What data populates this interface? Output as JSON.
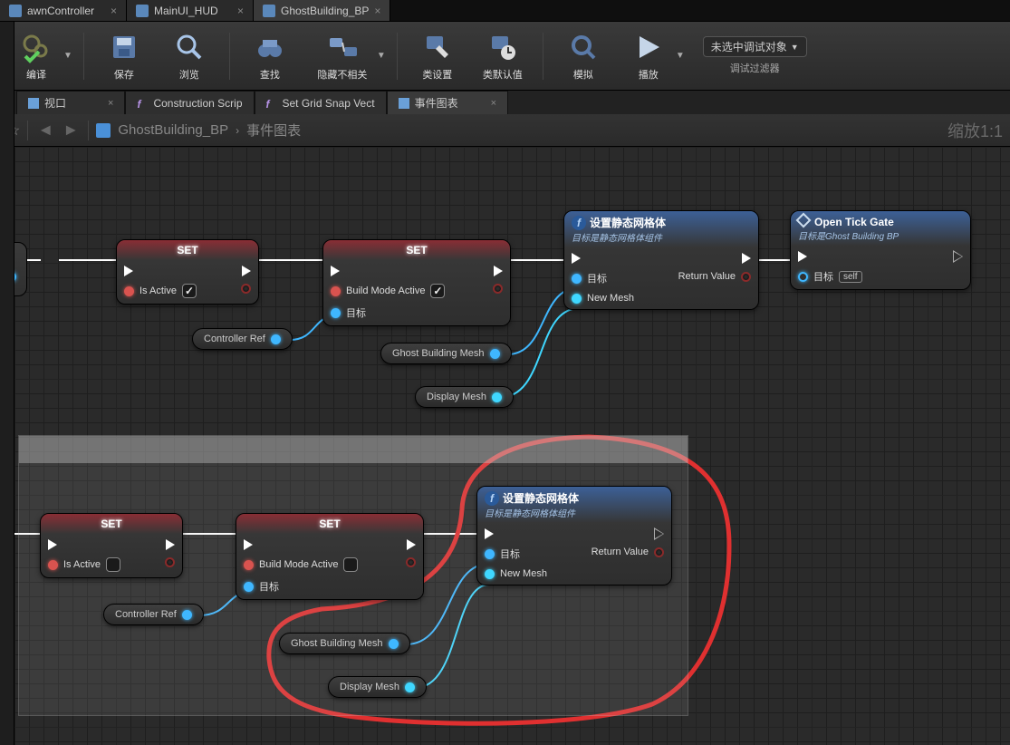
{
  "fileTabs": [
    {
      "label": "awnController"
    },
    {
      "label": "MainUI_HUD"
    },
    {
      "label": "GhostBuilding_BP",
      "active": true
    }
  ],
  "toolbar": {
    "compile": "编译",
    "save": "保存",
    "browse": "浏览",
    "find": "查找",
    "hideUnrelated": "隐藏不相关",
    "classSettings": "类设置",
    "classDefaults": "类默认值",
    "simulate": "模拟",
    "play": "播放",
    "noDebugSelected": "未选中调试对象",
    "debugFilter": "调试过滤器"
  },
  "subTabs": {
    "viewport": "视口",
    "constructionScript": "Construction Scrip",
    "setGridSnap": "Set Grid Snap Vect",
    "eventGraph": "事件图表"
  },
  "breadcrumb": {
    "blueprint": "GhostBuilding_BP",
    "graph": "事件图表",
    "zoom": "缩放1:1"
  },
  "nodes": {
    "setLabel": "SET",
    "isActive": "Is Active",
    "buildModeActive": "Build Mode Active",
    "target": "目标",
    "controllerRef": "Controller Ref",
    "ghostBuildingMesh": "Ghost Building Mesh",
    "displayMesh": "Display Mesh",
    "setStaticMesh": "设置静态网格体",
    "setStaticMeshSub": "目标是静态网格体组件",
    "newMesh": "New Mesh",
    "returnValue": "Return Value",
    "openTickGate": "Open Tick Gate",
    "openTickGateSub": "目标是Ghost Building BP",
    "self": "self"
  }
}
